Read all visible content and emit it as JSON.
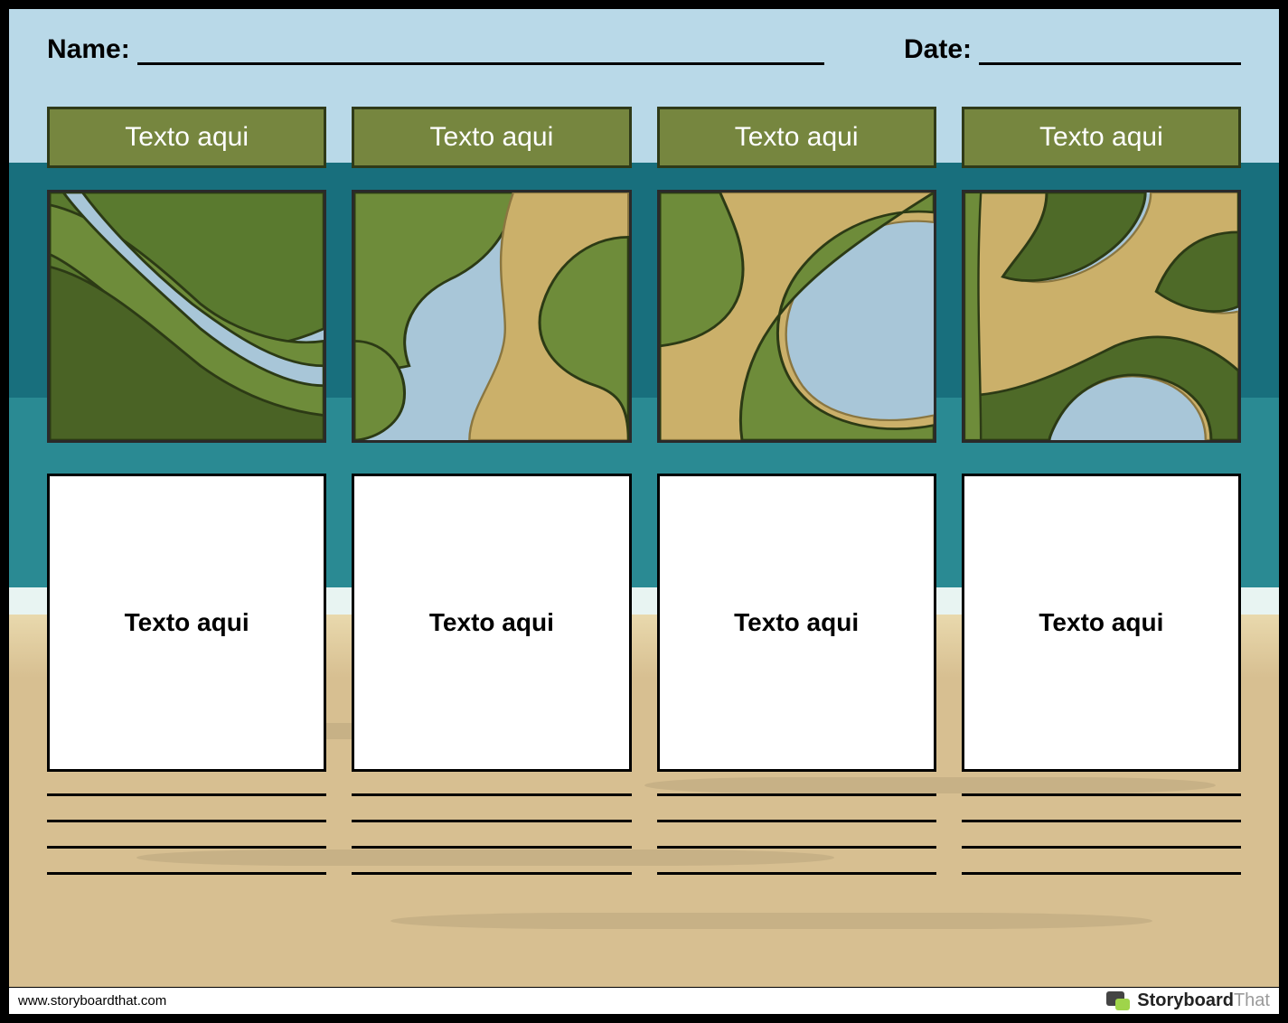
{
  "header": {
    "name_label": "Name:",
    "date_label": "Date:"
  },
  "columns": [
    {
      "tab": "Texto aqui",
      "textbox": "Texto aqui"
    },
    {
      "tab": "Texto aqui",
      "textbox": "Texto aqui"
    },
    {
      "tab": "Texto aqui",
      "textbox": "Texto aqui"
    },
    {
      "tab": "Texto aqui",
      "textbox": "Texto aqui"
    }
  ],
  "footer": {
    "url": "www.storyboardthat.com",
    "brand_bold": "Storyboard",
    "brand_light": "That"
  }
}
